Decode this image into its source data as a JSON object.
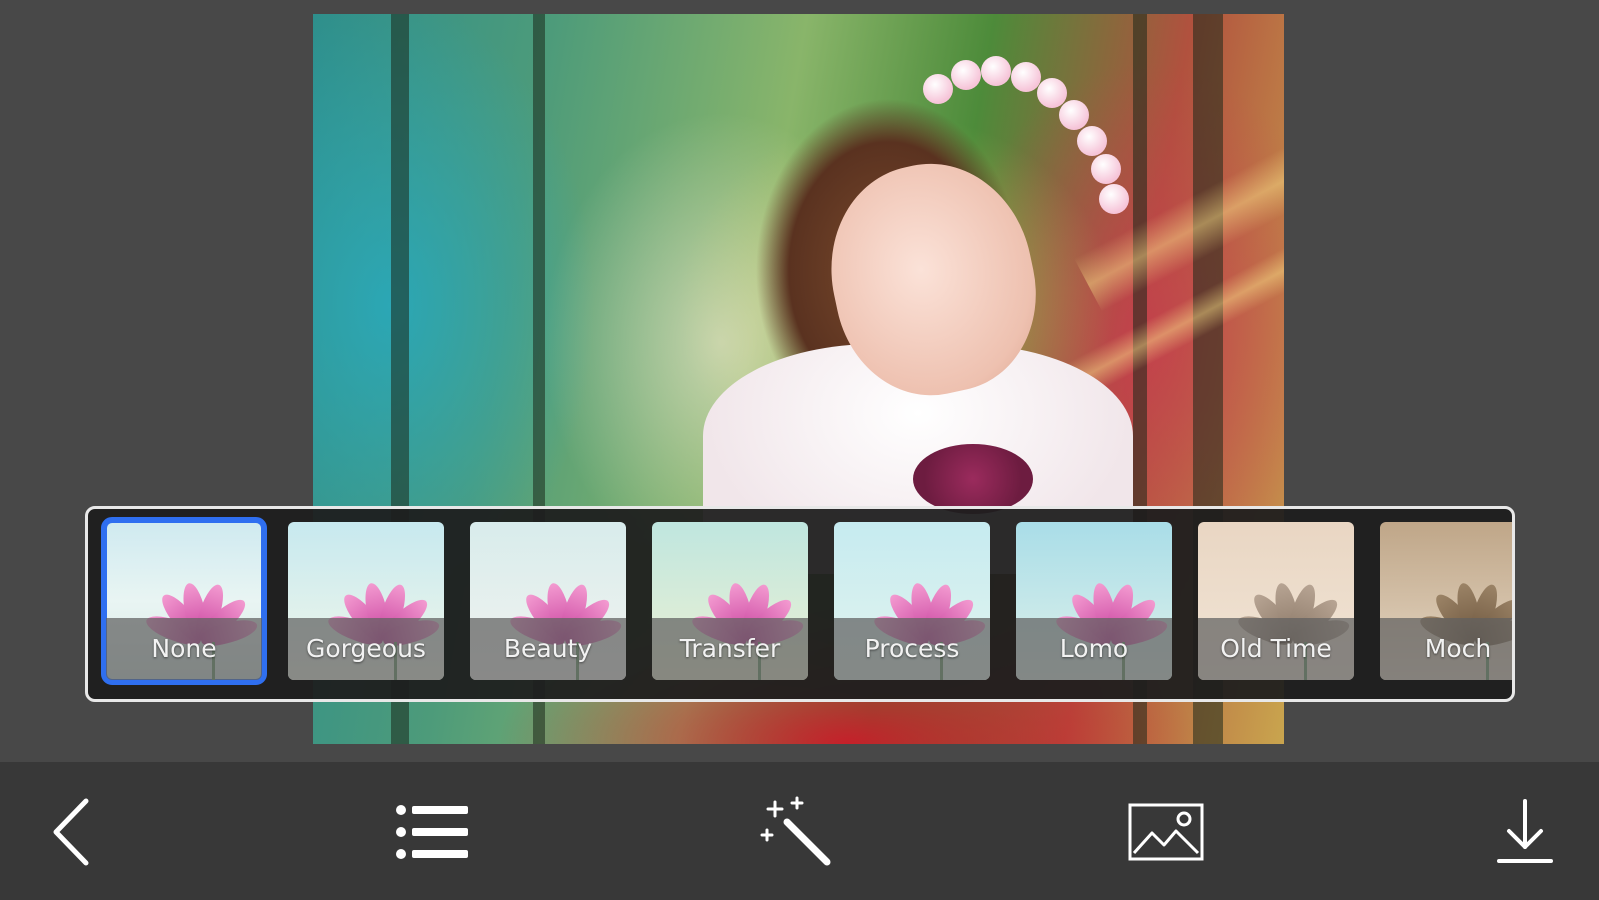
{
  "photo": {
    "icon": "portrait-photo"
  },
  "filters": {
    "selected": "None",
    "items": [
      {
        "label": "None"
      },
      {
        "label": "Gorgeous"
      },
      {
        "label": "Beauty"
      },
      {
        "label": "Transfer"
      },
      {
        "label": "Process"
      },
      {
        "label": "Lomo"
      },
      {
        "label": "Old Time"
      },
      {
        "label": "Moch"
      }
    ]
  },
  "toolbar": {
    "back_icon": "chevron-left-icon",
    "menu_icon": "list-icon",
    "effects_icon": "magic-wand-icon",
    "gallery_icon": "image-icon",
    "download_icon": "download-icon"
  },
  "colors": {
    "selected_outline": "#2f6ff0",
    "toolbar_background": "#383838",
    "background": "#484848"
  }
}
